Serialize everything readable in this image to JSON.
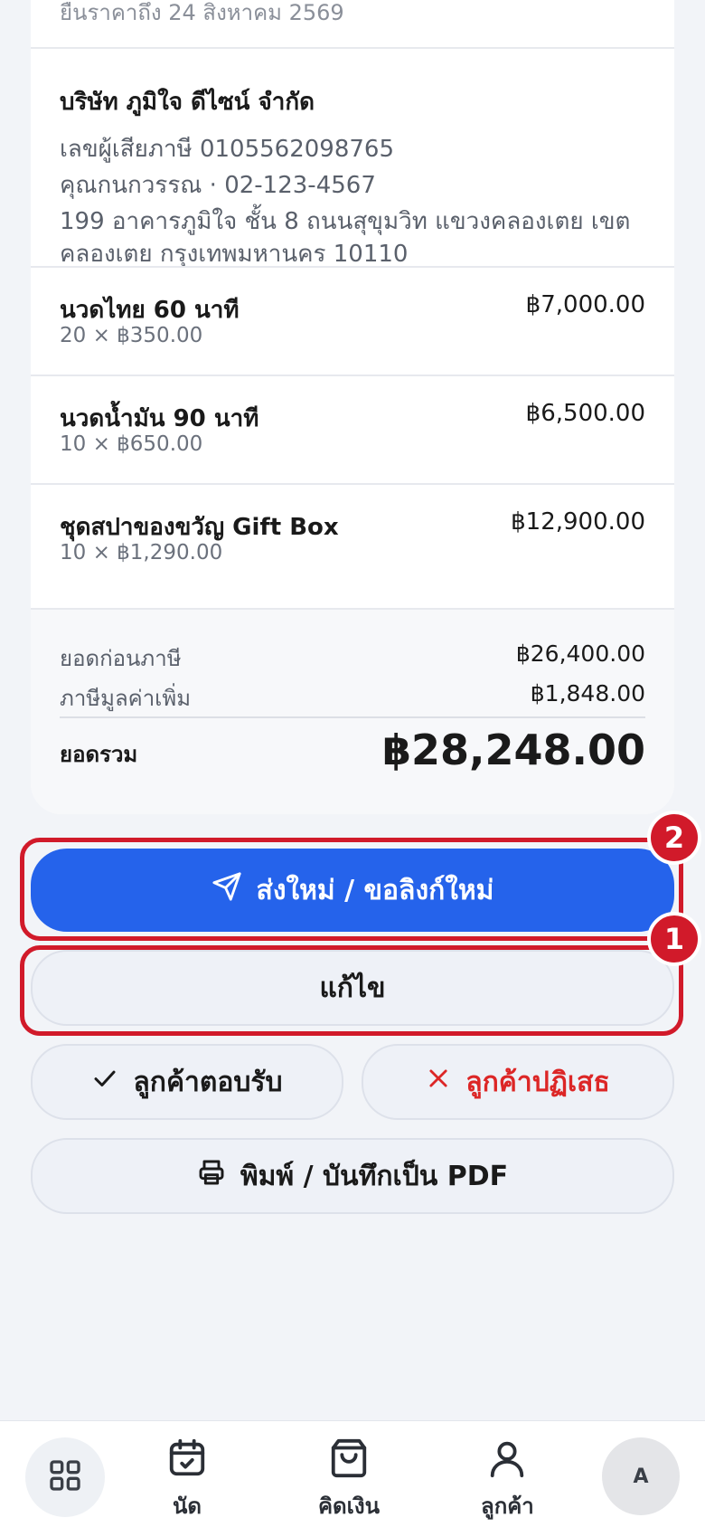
{
  "quote": {
    "valid_until": "ยืนราคาถึง 24 สิงหาคม 2569"
  },
  "customer": {
    "company": "บริษัท ภูมิใจ ดีไซน์ จำกัด",
    "tax_id": "เลขผู้เสียภาษี 0105562098765",
    "contact": "คุณกนกวรรณ · 02-123-4567",
    "address": "199 อาคารภูมิใจ ชั้น 8 ถนนสุขุมวิท แขวงคลองเตย เขตคลองเตย กรุงเทพมหานคร 10110"
  },
  "items": [
    {
      "name": "นวดไทย 60 นาที",
      "qty": "20 × ฿350.00",
      "total": "฿7,000.00"
    },
    {
      "name": "นวดน้ำมัน 90 นาที",
      "qty": "10 × ฿650.00",
      "total": "฿6,500.00"
    },
    {
      "name": "ชุดสปาของขวัญ Gift Box",
      "qty": "10 × ฿1,290.00",
      "total": "฿12,900.00"
    }
  ],
  "summary": {
    "subtotal_label": "ยอดก่อนภาษี",
    "subtotal": "฿26,400.00",
    "vat_label": "ภาษีมูลค่าเพิ่ม",
    "vat": "฿1,848.00",
    "total_label": "ยอดรวม",
    "total": "฿28,248.00"
  },
  "actions": {
    "resend": "ส่งใหม่ / ขอลิงก์ใหม่",
    "edit": "แก้ไข",
    "accept": "ลูกค้าตอบรับ",
    "reject": "ลูกค้าปฏิเสธ",
    "print": "พิมพ์ / บันทึกเป็น PDF"
  },
  "annotations": {
    "badge_resend": "2",
    "badge_edit": "1"
  },
  "tabbar": {
    "appointments": "นัด",
    "billing": "คิดเงิน",
    "customers": "ลูกค้า",
    "avatar_initial": "A"
  },
  "colors": {
    "primary": "#2563eb",
    "danger": "#dc2626",
    "highlight": "#d11a2a"
  },
  "icons": {
    "resend": "send-icon",
    "accept": "check-icon",
    "reject": "x-icon",
    "print": "printer-icon",
    "home": "grid-icon",
    "appointments": "calendar-check-icon",
    "billing": "shopping-bag-icon",
    "customers": "user-icon"
  }
}
